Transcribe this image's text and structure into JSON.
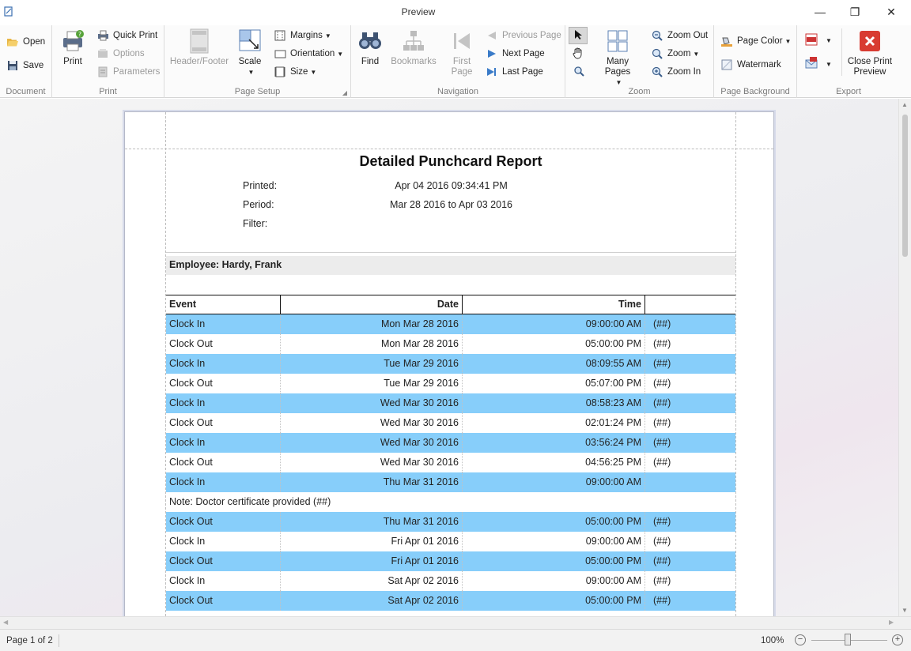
{
  "window": {
    "title": "Preview",
    "minimize": "—",
    "restore": "❐",
    "close": "✕"
  },
  "ribbon": {
    "groups": {
      "document": "Document",
      "print": "Print",
      "page_setup": "Page Setup",
      "navigation": "Navigation",
      "zoom": "Zoom",
      "page_background": "Page Background",
      "export": "Export"
    },
    "open": "Open",
    "save": "Save",
    "print_big": "Print",
    "quick_print": "Quick Print",
    "options": "Options",
    "parameters": "Parameters",
    "header_footer": "Header/Footer",
    "scale": "Scale",
    "margins": "Margins",
    "orientation": "Orientation",
    "size": "Size",
    "find": "Find",
    "bookmarks": "Bookmarks",
    "first_page_1": "First",
    "first_page_2": "Page",
    "previous_page": "Previous Page",
    "next_page": "Next Page",
    "last_page": "Last Page",
    "many_pages": "Many Pages",
    "zoom_out": "Zoom Out",
    "zoom": "Zoom",
    "zoom_in": "Zoom In",
    "page_color": "Page Color",
    "watermark": "Watermark",
    "close_preview_1": "Close Print",
    "close_preview_2": "Preview"
  },
  "report": {
    "title": "Detailed Punchcard Report",
    "printed_label": "Printed:",
    "printed_value": "Apr 04 2016 09:34:41 PM",
    "period_label": "Period:",
    "period_value": "Mar 28 2016 to Apr 03 2016",
    "filter_label": "Filter:",
    "employee": "Employee: Hardy, Frank",
    "columns": {
      "event": "Event",
      "date": "Date",
      "time": "Time"
    },
    "rows": [
      {
        "event": "Clock In",
        "date": "Mon Mar 28 2016",
        "time": "09:00:00 AM",
        "flag": "(##)"
      },
      {
        "event": "Clock Out",
        "date": "Mon Mar 28 2016",
        "time": "05:00:00 PM",
        "flag": "(##)"
      },
      {
        "event": "Clock In",
        "date": "Tue Mar 29 2016",
        "time": "08:09:55 AM",
        "flag": "(##)"
      },
      {
        "event": "Clock Out",
        "date": "Tue Mar 29 2016",
        "time": "05:07:00 PM",
        "flag": "(##)"
      },
      {
        "event": "Clock In",
        "date": "Wed Mar 30 2016",
        "time": "08:58:23 AM",
        "flag": "(##)"
      },
      {
        "event": "Clock Out",
        "date": "Wed Mar 30 2016",
        "time": "02:01:24 PM",
        "flag": "(##)"
      },
      {
        "event": "Clock In",
        "date": "Wed Mar 30 2016",
        "time": "03:56:24 PM",
        "flag": "(##)"
      },
      {
        "event": "Clock Out",
        "date": "Wed Mar 30 2016",
        "time": "04:56:25 PM",
        "flag": "(##)"
      },
      {
        "event": "Clock In",
        "date": "Thu Mar 31 2016",
        "time": "09:00:00 AM",
        "flag": ""
      },
      {
        "note": "Note: Doctor certificate provided (##)"
      },
      {
        "event": "Clock Out",
        "date": "Thu Mar 31 2016",
        "time": "05:00:00 PM",
        "flag": "(##)"
      },
      {
        "event": "Clock In",
        "date": "Fri Apr 01 2016",
        "time": "09:00:00 AM",
        "flag": "(##)"
      },
      {
        "event": "Clock Out",
        "date": "Fri Apr 01 2016",
        "time": "05:00:00 PM",
        "flag": "(##)"
      },
      {
        "event": "Clock In",
        "date": "Sat Apr 02 2016",
        "time": "09:00:00 AM",
        "flag": "(##)"
      },
      {
        "event": "Clock Out",
        "date": "Sat Apr 02 2016",
        "time": "05:00:00 PM",
        "flag": "(##)"
      }
    ]
  },
  "status": {
    "page": "Page 1 of 2",
    "zoom": "100%",
    "zoom_minus": "−",
    "zoom_plus": "+"
  },
  "colors": {
    "row_highlight": "#87cefa",
    "close_red": "#d83b31"
  }
}
